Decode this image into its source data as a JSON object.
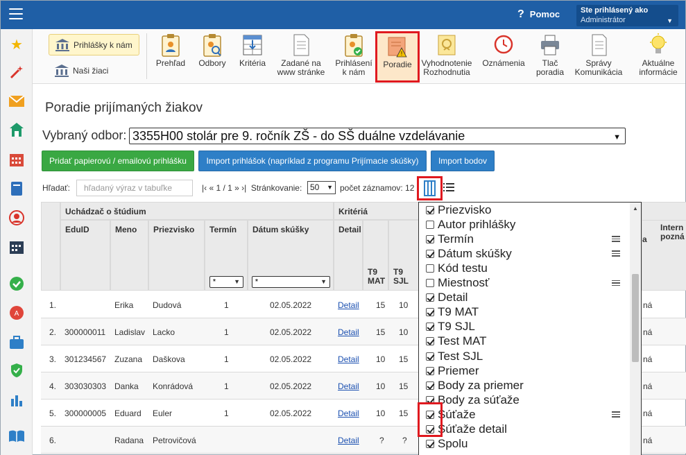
{
  "header": {
    "help_label": "Pomoc",
    "user_line1": "Ste prihlásený ako",
    "user_line2": "Administrátor"
  },
  "ribbon": {
    "applications_to_us": "Prihlášky k nám",
    "our_students": "Naši žiaci",
    "tools": [
      {
        "label": "Prehľad",
        "icon": "clipboard-person-icon"
      },
      {
        "label": "Odbory",
        "icon": "clipboard-search-icon"
      },
      {
        "label": "Kritéria",
        "icon": "criteria-grid-icon"
      },
      {
        "label": "Zadané na\nwww stránke",
        "icon": "document-icon"
      },
      {
        "label": "Prihlásení\nk nám",
        "icon": "clipboard-check-icon"
      },
      {
        "label": "Poradie",
        "icon": "warning-document-icon"
      },
      {
        "label": "Vyhodnotenie\nRozhodnutia",
        "icon": "decision-document-icon"
      },
      {
        "label": "Oznámenia",
        "icon": "clock-icon"
      },
      {
        "label": "Tlač\nporadia",
        "icon": "printer-icon"
      },
      {
        "label": "Správy\nKomunikácia",
        "icon": "messages-icon"
      },
      {
        "label": "Aktuálne\ninformácie",
        "icon": "lightbulb-icon"
      }
    ]
  },
  "page": {
    "title": "Poradie prijímaných žiakov",
    "odbor_label": "Vybraný odbor:",
    "odbor_value": "3355H00 stolár pre 9. ročník ZŠ - do SŠ duálne vzdelávanie",
    "btn_add": "Pridať papierovú / emailovú prihlášku",
    "btn_import": "Import prihlášok (napríklad z programu Prijímacie skúšky)",
    "btn_import_points": "Import bodov",
    "search_label": "Hľadať:",
    "search_placeholder": "hľadaný výraz v tabuľke",
    "pager_text": "|‹ « 1 / 1 » ›|  Stránkovanie:",
    "page_size": "50",
    "count_text": "počet záznamov: 12"
  },
  "table": {
    "group_student": "Uchádzač o štúdium",
    "group_criteria": "Kritériá",
    "col_eduid": "EduID",
    "col_meno": "Meno",
    "col_priezvisko": "Priezvisko",
    "col_termin": "Termín",
    "col_datum": "Dátum skúšky",
    "col_detail": "Detail",
    "col_t9mat": "T9\nMAT",
    "col_t9sjl": "T9\nSJL",
    "col_intern": "Intern\npozná",
    "filter_value": "*",
    "rows": [
      {
        "num": "1.",
        "eduid": "",
        "meno": "Erika",
        "priezvisko": "Dudová",
        "termin": "1",
        "datum": "02.05.2022",
        "detail": "Detail",
        "mat": "15",
        "sjl": "10",
        "status": "ná"
      },
      {
        "num": "2.",
        "eduid": "300000011",
        "meno": "Ladislav",
        "priezvisko": "Lacko",
        "termin": "1",
        "datum": "02.05.2022",
        "detail": "Detail",
        "mat": "15",
        "sjl": "10",
        "status": "ná"
      },
      {
        "num": "3.",
        "eduid": "301234567",
        "meno": "Zuzana",
        "priezvisko": "Daškova",
        "termin": "1",
        "datum": "02.05.2022",
        "detail": "Detail",
        "mat": "10",
        "sjl": "15",
        "status": "ná"
      },
      {
        "num": "4.",
        "eduid": "303030303",
        "meno": "Danka",
        "priezvisko": "Konrádová",
        "termin": "1",
        "datum": "02.05.2022",
        "detail": "Detail",
        "mat": "10",
        "sjl": "15",
        "status": "ná"
      },
      {
        "num": "5.",
        "eduid": "300000005",
        "meno": "Eduard",
        "priezvisko": "Euler",
        "termin": "1",
        "datum": "02.05.2022",
        "detail": "Detail",
        "mat": "10",
        "sjl": "15",
        "status": "ná"
      },
      {
        "num": "6.",
        "eduid": "",
        "meno": "Radana",
        "priezvisko": "Petrovičová",
        "termin": "",
        "datum": "",
        "detail": "Detail",
        "mat": "?",
        "sjl": "?",
        "status": "ná"
      }
    ],
    "status_header_tail": "a"
  },
  "column_chooser": {
    "items": [
      {
        "label": "Priezvisko",
        "checked": true,
        "lines": false
      },
      {
        "label": "Autor prihlášky",
        "checked": false,
        "lines": false
      },
      {
        "label": "Termín",
        "checked": true,
        "lines": true
      },
      {
        "label": "Dátum skúšky",
        "checked": true,
        "lines": true
      },
      {
        "label": "Kód testu",
        "checked": false,
        "lines": false
      },
      {
        "label": "Miestnosť",
        "checked": false,
        "lines": true
      },
      {
        "label": "Detail",
        "checked": true,
        "lines": false
      },
      {
        "label": "T9 MAT",
        "checked": true,
        "lines": false
      },
      {
        "label": "T9 SJL",
        "checked": true,
        "lines": false
      },
      {
        "label": "Test MAT",
        "checked": true,
        "lines": false
      },
      {
        "label": "Test SJL",
        "checked": true,
        "lines": false
      },
      {
        "label": "Priemer",
        "checked": true,
        "lines": false
      },
      {
        "label": "Body za priemer",
        "checked": true,
        "lines": false
      },
      {
        "label": "Body za súťaže",
        "checked": true,
        "lines": false
      },
      {
        "label": "Súťaže",
        "checked": true,
        "lines": true
      },
      {
        "label": "Súťaže detail",
        "checked": true,
        "lines": false
      },
      {
        "label": "Spolu",
        "checked": true,
        "lines": false
      }
    ]
  },
  "colors": {
    "topbar": "#1f5fa6",
    "highlight": "#e0191f",
    "green_button": "#3aa843",
    "blue_button": "#2e7fc7"
  }
}
